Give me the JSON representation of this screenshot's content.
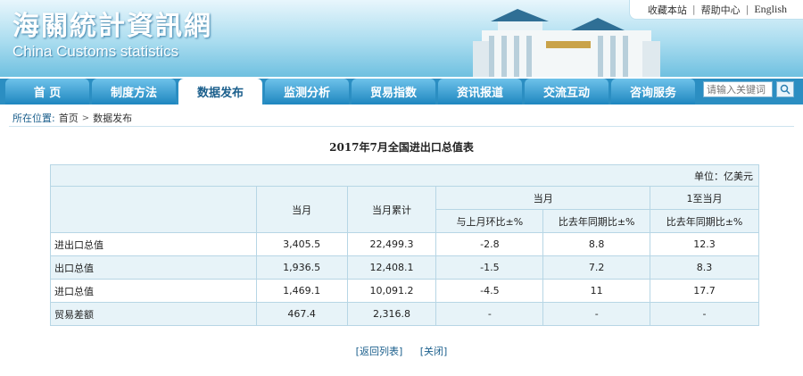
{
  "header": {
    "brand_cn": "海關統計資訊網",
    "brand_en": "China Customs statistics",
    "top_links": [
      "收藏本站",
      "帮助中心",
      "English"
    ]
  },
  "nav": {
    "tabs": [
      "首 页",
      "制度方法",
      "数据发布",
      "监测分析",
      "贸易指数",
      "资讯报道",
      "交流互动",
      "咨询服务"
    ],
    "active_index": 2
  },
  "search": {
    "placeholder": "请输入关键词"
  },
  "breadcrumb": {
    "label": "所在位置:",
    "home": "首页",
    "current": "数据发布"
  },
  "table": {
    "title": "2017年7月全国进出口总值表",
    "unit": "单位：亿美元",
    "headers": {
      "month": "当月",
      "cumulative": "当月累计",
      "group_month": "当月",
      "group_cumulative": "1至当月",
      "mom": "与上月环比±%",
      "yoy": "比去年同期比±%",
      "ytd_yoy": "比去年同期比±%"
    },
    "rows": [
      {
        "name": "进出口总值",
        "month": "3,405.5",
        "cumulative": "22,499.3",
        "mom": "-2.8",
        "yoy": "8.8",
        "ytd_yoy": "12.3"
      },
      {
        "name": "出口总值",
        "month": "1,936.5",
        "cumulative": "12,408.1",
        "mom": "-1.5",
        "yoy": "7.2",
        "ytd_yoy": "8.3"
      },
      {
        "name": "进口总值",
        "month": "1,469.1",
        "cumulative": "10,091.2",
        "mom": "-4.5",
        "yoy": "11",
        "ytd_yoy": "17.7"
      },
      {
        "name": "贸易差额",
        "month": "467.4",
        "cumulative": "2,316.8",
        "mom": "-",
        "yoy": "-",
        "ytd_yoy": "-"
      }
    ]
  },
  "actions": {
    "back": "[返回列表]",
    "close": "[关闭]"
  }
}
